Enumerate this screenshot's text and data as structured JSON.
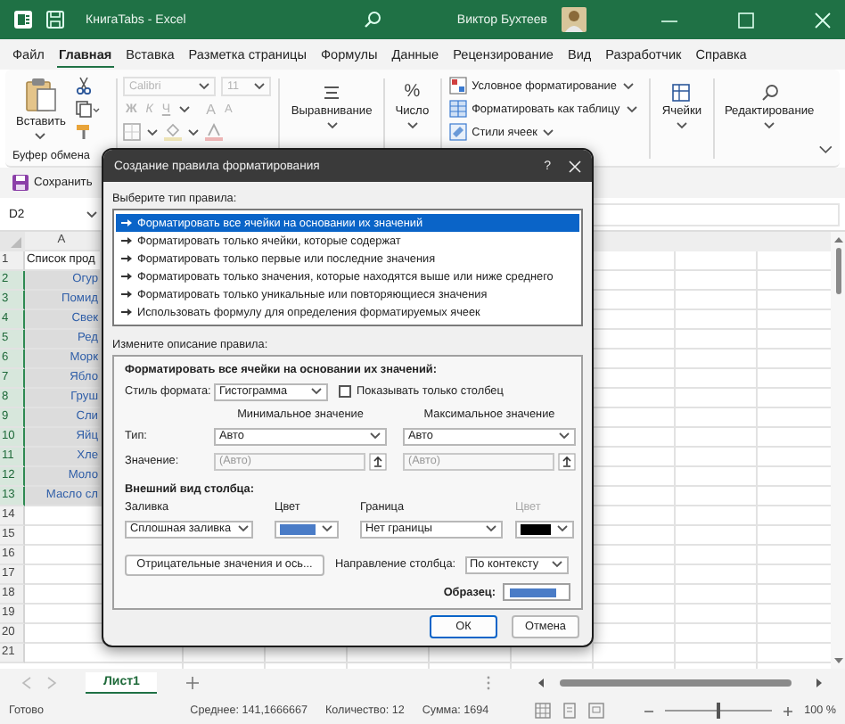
{
  "window": {
    "title": "КнигаTabs - Excel",
    "user": "Виктор Бухтеев"
  },
  "ribbon_tabs": [
    {
      "label": "Файл",
      "selected": false
    },
    {
      "label": "Главная",
      "selected": true
    },
    {
      "label": "Вставка",
      "selected": false
    },
    {
      "label": "Разметка страницы",
      "selected": false
    },
    {
      "label": "Формулы",
      "selected": false
    },
    {
      "label": "Данные",
      "selected": false
    },
    {
      "label": "Рецензирование",
      "selected": false
    },
    {
      "label": "Вид",
      "selected": false
    },
    {
      "label": "Разработчик",
      "selected": false
    },
    {
      "label": "Справка",
      "selected": false
    }
  ],
  "ribbon": {
    "paste": "Вставить",
    "clipboard_group": "Буфер обмена",
    "font": {
      "name": "Calibri",
      "size": "11",
      "bold": "Ж",
      "italic": "К",
      "underline": "Ч",
      "grow": "A",
      "shrink": "A",
      "disabled": true
    },
    "alignment": "Выравнивание",
    "number_symbol": "%",
    "number": "Число",
    "styles": [
      "Условное форматирование",
      "Форматировать как таблицу",
      "Стили ячеек"
    ],
    "cells": "Ячейки",
    "editing": "Редактирование"
  },
  "quick_access": {
    "save": "Сохранить"
  },
  "name_box": "D2",
  "sheet": {
    "column_header": "A",
    "rows": [
      {
        "number": "1",
        "cell": "Список прод",
        "selected": false
      },
      {
        "number": "2",
        "cell": "Огур",
        "selected": true
      },
      {
        "number": "3",
        "cell": "Помид",
        "selected": true
      },
      {
        "number": "4",
        "cell": "Свек",
        "selected": true
      },
      {
        "number": "5",
        "cell": "Ред",
        "selected": true
      },
      {
        "number": "6",
        "cell": "Морк",
        "selected": true
      },
      {
        "number": "7",
        "cell": "Ябло",
        "selected": true
      },
      {
        "number": "8",
        "cell": "Груш",
        "selected": true
      },
      {
        "number": "9",
        "cell": "Сли",
        "selected": true
      },
      {
        "number": "10",
        "cell": "Яйц",
        "selected": true
      },
      {
        "number": "11",
        "cell": "Хле",
        "selected": true
      },
      {
        "number": "12",
        "cell": "Моло",
        "selected": true
      },
      {
        "number": "13",
        "cell": "Масло сл",
        "selected": true
      },
      {
        "number": "14",
        "selected": false
      },
      {
        "number": "15",
        "selected": false
      },
      {
        "number": "16",
        "selected": false
      },
      {
        "number": "17",
        "selected": false
      },
      {
        "number": "18",
        "selected": false
      },
      {
        "number": "19",
        "selected": false
      },
      {
        "number": "20",
        "selected": false
      },
      {
        "number": "21",
        "selected": false
      }
    ]
  },
  "dialog": {
    "title": "Создание правила форматирования",
    "help": "?",
    "rule_type_label": "Выберите тип правила:",
    "rule_types": [
      {
        "label": "Форматировать все ячейки на основании их значений",
        "selected": true
      },
      {
        "label": "Форматировать только ячейки, которые содержат",
        "selected": false
      },
      {
        "label": "Форматировать только первые или последние значения",
        "selected": false
      },
      {
        "label": "Форматировать только значения, которые находятся выше или ниже среднего",
        "selected": false
      },
      {
        "label": "Форматировать только уникальные или повторяющиеся значения",
        "selected": false
      },
      {
        "label": "Использовать формулу для определения форматируемых ячеек",
        "selected": false
      }
    ],
    "description_label": "Измените описание правила:",
    "heading": "Форматировать все ячейки на основании их значений:",
    "format_style": {
      "label": "Стиль формата:",
      "value": "Гистограмма"
    },
    "bar_only": {
      "label": "Показывать только столбец",
      "checked": false
    },
    "type_label": "Тип:",
    "value_label": "Значение:",
    "minimum": {
      "heading": "Минимальное значение",
      "type": "Авто",
      "placeholder": "(Авто)"
    },
    "maximum": {
      "heading": "Максимальное значение",
      "type": "Авто",
      "placeholder": "(Авто)"
    },
    "appearance_label": "Внешний вид столбца:",
    "fill": {
      "label": "Заливка",
      "value": "Сплошная заливка"
    },
    "fill_color": {
      "label": "Цвет",
      "color": "#4a7cc7"
    },
    "border": {
      "label": "Граница",
      "value": "Нет границы"
    },
    "border_color": {
      "label": "Цвет",
      "color": "#000000",
      "disabled": true
    },
    "negative_button": "Отрицательные значения и ось...",
    "direction": {
      "label": "Направление столбца:",
      "value": "По контексту"
    },
    "preview_label": "Образец:",
    "buttons": [
      {
        "label": "ОК",
        "default": true
      },
      {
        "label": "Отмена",
        "default": false
      }
    ]
  },
  "sheet_tabs": [
    {
      "label": "Лист1",
      "selected": true
    }
  ],
  "status_bar": {
    "status": "Готово",
    "average": "Среднее: 141,1666667",
    "count": "Количество: 12",
    "sum": "Сумма: 1694",
    "zoom": "100 %",
    "zoom_level": {
      "level": 0.5
    }
  }
}
